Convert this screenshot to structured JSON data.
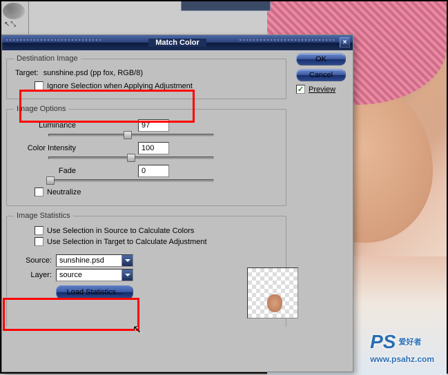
{
  "dialog": {
    "title": "Match Color",
    "destination": {
      "legend": "Destination Image",
      "target_label": "Target:",
      "target_value": "sunshine.psd (pp fox, RGB/8)",
      "ignore_label": "Ignore Selection when Applying Adjustment"
    },
    "options": {
      "legend": "Image Options",
      "luminance": {
        "label": "Luminance",
        "value": "97",
        "pos": 48
      },
      "intensity": {
        "label": "Color Intensity",
        "value": "100",
        "pos": 50
      },
      "fade": {
        "label": "Fade",
        "value": "0",
        "pos": 0
      },
      "neutralize": "Neutralize"
    },
    "stats": {
      "legend": "Image Statistics",
      "use_source": "Use Selection in Source to Calculate Colors",
      "use_target": "Use Selection in Target to Calculate Adjustment",
      "source_label": "Source:",
      "source_value": "sunshine.psd",
      "layer_label": "Layer:",
      "layer_value": "source",
      "load_btn": "Load Statistics..."
    },
    "buttons": {
      "ok": "OK",
      "cancel": "Cancel",
      "preview": "Preview"
    }
  },
  "watermark": {
    "logo": "PS",
    "cn": "爱好者",
    "url": "www.psahz.com"
  }
}
